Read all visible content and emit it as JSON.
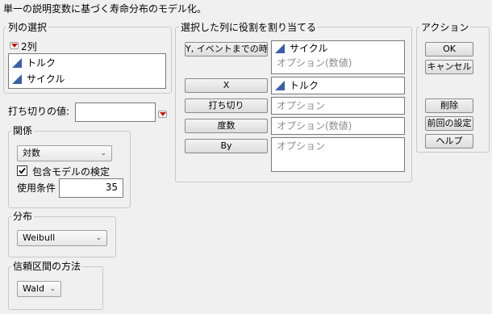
{
  "title": "単一の説明変数に基づく寿命分布のモデル化。",
  "select_columns": {
    "legend": "列の選択",
    "count_label": "2列",
    "columns": [
      {
        "name": "トルク",
        "icon": "continuous-column-icon"
      },
      {
        "name": "サイクル",
        "icon": "continuous-column-icon"
      }
    ]
  },
  "censor": {
    "label": "打ち切りの値:",
    "value": ""
  },
  "relationship": {
    "legend": "関係",
    "selected": "対数",
    "checkbox_label": "包含モデルの検定",
    "checked": true,
    "use_condition_label": "使用条件",
    "use_condition_value": "35"
  },
  "distribution": {
    "legend": "分布",
    "selected": "Weibull"
  },
  "ci_method": {
    "legend": "信頼区間の方法",
    "selected": "Wald"
  },
  "cast": {
    "legend": "選択した列に役割を割り当てる",
    "roles": [
      {
        "button": "Y, イベントまでの時間",
        "items": [
          "サイクル"
        ],
        "placeholder": "オプション(数値)"
      },
      {
        "button": "X",
        "items": [
          "トルク"
        ],
        "placeholder": ""
      },
      {
        "button": "打ち切り",
        "items": [],
        "placeholder": "オプション"
      },
      {
        "button": "度数",
        "items": [],
        "placeholder": "オプション(数値)"
      },
      {
        "button": "By",
        "items": [],
        "placeholder": "オプション"
      }
    ]
  },
  "action": {
    "legend": "アクション",
    "ok": "OK",
    "cancel": "キャンセル",
    "remove": "削除",
    "recall": "前回の設定",
    "help": "ヘルプ"
  },
  "colors": {
    "column_icon": "#3c5ea8",
    "red_triangle": "#d01010"
  }
}
